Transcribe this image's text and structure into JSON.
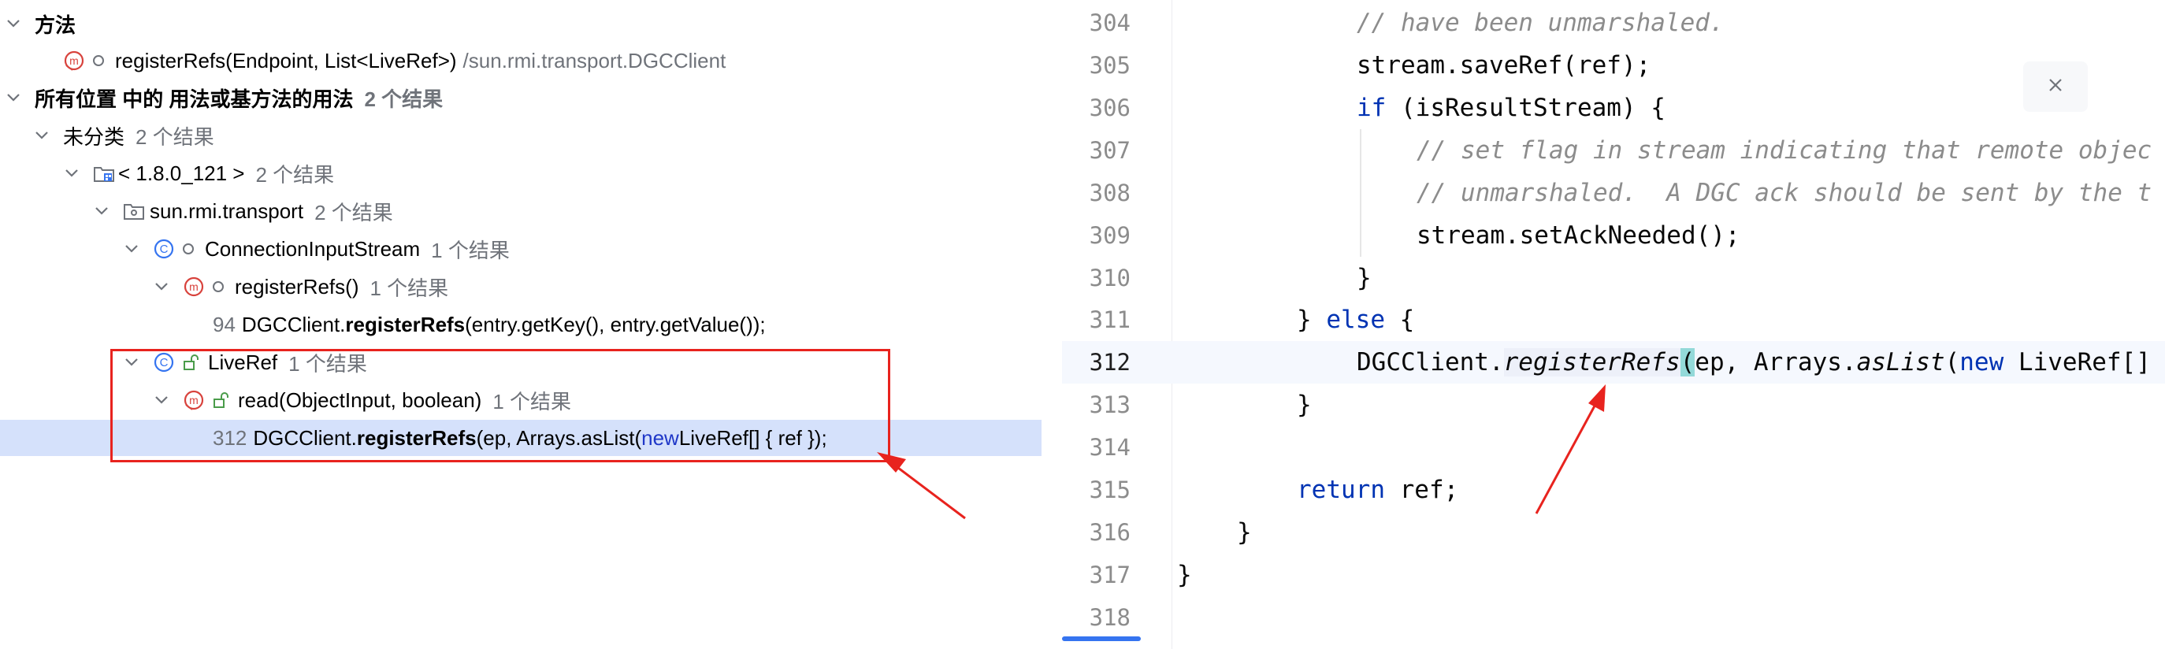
{
  "tree": {
    "rows": [
      {
        "text": "方法"
      },
      {
        "text": "registerRefs(Endpoint, List<LiveRef>)",
        "path": "/sun.rmi.transport.DGCClient"
      },
      {
        "text": "所有位置 中的 用法或基方法的用法",
        "count": "2 个结果"
      },
      {
        "text": "未分类",
        "count": "2 个结果"
      },
      {
        "text": "< 1.8.0_121 >",
        "count": "2 个结果"
      },
      {
        "text": "sun.rmi.transport",
        "count": "2 个结果"
      },
      {
        "text": "ConnectionInputStream",
        "count": "1 个结果"
      },
      {
        "text": "registerRefs()",
        "count": "1 个结果"
      },
      {
        "lineno": "94",
        "pre": "DGCClient.",
        "bold": "registerRefs",
        "post": "(entry.getKey(), entry.getValue());"
      },
      {
        "text": "LiveRef",
        "count": "1 个结果"
      },
      {
        "text": "read(ObjectInput, boolean)",
        "count": "1 个结果"
      },
      {
        "lineno": "312",
        "pre": "DGCClient.",
        "bold": "registerRefs",
        "mid": "(ep, Arrays.asList(",
        "kw": "new",
        "post": " LiveRef[] { ref });"
      }
    ]
  },
  "editor": {
    "lines": [
      "304",
      "305",
      "306",
      "307",
      "308",
      "309",
      "310",
      "311",
      "312",
      "313",
      "314",
      "315",
      "316",
      "317",
      "318"
    ],
    "code": {
      "l304": "// have been unmarshaled.",
      "l305": "stream.saveRef(ref);",
      "l306_kw": "if",
      "l306_rest": " (isResultStream) {",
      "l307": "// set flag in stream indicating that remote objec",
      "l308": "// unmarshaled.  A DGC ack should be sent by the t",
      "l309": "stream.setAckNeeded();",
      "l310": "}",
      "l311_a": "} ",
      "l311_kw": "else",
      "l311_b": " {",
      "l312_a": "DGCClient.",
      "l312_method": "registerRefs",
      "l312_paren": "(",
      "l312_b": "ep, Arrays.",
      "l312_aslist": "asList",
      "l312_c": "(",
      "l312_kw": "new",
      "l312_d": " LiveRef[]",
      "l313": "}",
      "l315_kw": "return",
      "l315_rest": " ref;",
      "l316": "}",
      "l317": "}"
    }
  },
  "colors": {
    "accent": "#3574f0",
    "annotation": "#e8231e",
    "selection": "#d5e1fb",
    "keyword": "#0033b3",
    "comment": "#8c8c8c"
  },
  "icons": [
    "chevron-down-icon",
    "method-icon",
    "class-icon",
    "package-icon",
    "module-icon",
    "close-icon",
    "lock-open-icon",
    "dot-circle-icon"
  ]
}
